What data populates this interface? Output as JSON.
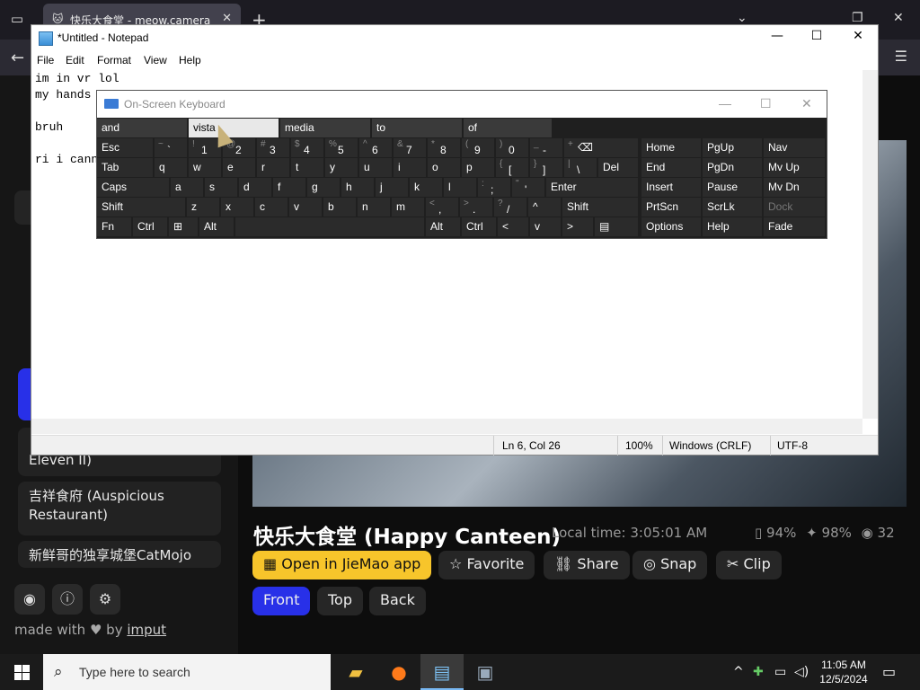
{
  "browser": {
    "tab_title": "快乐大食堂 - meow.camera",
    "tab_close": "✕",
    "new_tab": "+",
    "icons": [
      "tab-list-icon",
      "back-icon",
      "signin-icon",
      "hamburger-icon",
      "chevron-down-icon",
      "restore-icon",
      "close-icon"
    ]
  },
  "page": {
    "sidebar": {
      "items": [
        {
          "label": "Eleven II)"
        },
        {
          "label": "吉祥食府 (Auspicious Restaurant)"
        },
        {
          "label": "新鲜哥的独享城堡CatMojo"
        }
      ],
      "made_with_prefix": "made with",
      "made_with_heart": "♥",
      "made_with_by": "by",
      "made_with_link": "imput"
    },
    "camera": {
      "title": "快乐大食堂 (Happy Canteen)",
      "local_time": "Local time: 3:05:01 AM",
      "stats": {
        "battery": "94%",
        "signal": "98%",
        "viewers": "32"
      }
    },
    "actions": {
      "open_app": "Open in JieMao app",
      "favorite": "Favorite",
      "share": "Share",
      "snap": "Snap",
      "clip": "Clip"
    },
    "views": {
      "front": "Front",
      "top": "Top",
      "back": "Back"
    }
  },
  "notepad": {
    "title": "*Untitled - Notepad",
    "menus": {
      "file": "File",
      "edit": "Edit",
      "format": "Format",
      "view": "View",
      "help": "Help"
    },
    "content": "im in vr lol\nmy hands\n\nbruh\n\nri i cann",
    "status": {
      "position": "Ln 6, Col 26",
      "zoom": "100%",
      "eol": "Windows (CRLF)",
      "encoding": "UTF-8"
    },
    "winbtns": {
      "min": "—",
      "max": "☐",
      "close": "✕"
    }
  },
  "osk": {
    "title": "On-Screen Keyboard",
    "predictions": [
      "and",
      "vista",
      "media",
      "to",
      "of"
    ],
    "row1": {
      "esc": "Esc",
      "keys": [
        {
          "shift": "~",
          "main": "`"
        },
        {
          "shift": "!",
          "main": "1"
        },
        {
          "shift": "@",
          "main": "2"
        },
        {
          "shift": "#",
          "main": "3"
        },
        {
          "shift": "$",
          "main": "4"
        },
        {
          "shift": "%",
          "main": "5"
        },
        {
          "shift": "^",
          "main": "6"
        },
        {
          "shift": "&",
          "main": "7"
        },
        {
          "shift": "*",
          "main": "8"
        },
        {
          "shift": "(",
          "main": "9"
        },
        {
          "shift": ")",
          "main": "0"
        },
        {
          "shift": "_",
          "main": "-"
        },
        {
          "shift": "+",
          "main": "="
        }
      ],
      "backspace": "⌫",
      "nav": [
        "Home",
        "PgUp",
        "Nav"
      ]
    },
    "row2": {
      "tab": "Tab",
      "keys": [
        "q",
        "w",
        "e",
        "r",
        "t",
        "y",
        "u",
        "i",
        "o",
        "p"
      ],
      "brackets": [
        {
          "shift": "{",
          "main": "["
        },
        {
          "shift": "}",
          "main": "]"
        },
        {
          "shift": "|",
          "main": "\\"
        }
      ],
      "del": "Del",
      "nav": [
        "End",
        "PgDn",
        "Mv Up"
      ]
    },
    "row3": {
      "caps": "Caps",
      "keys": [
        "a",
        "s",
        "d",
        "f",
        "g",
        "h",
        "j",
        "k",
        "l"
      ],
      "punct": [
        {
          "shift": ":",
          "main": ";"
        },
        {
          "shift": "\"",
          "main": "'"
        }
      ],
      "enter": "Enter",
      "nav": [
        "Insert",
        "Pause",
        "Mv Dn"
      ]
    },
    "row4": {
      "shift_left": "Shift",
      "keys": [
        "z",
        "x",
        "c",
        "v",
        "b",
        "n",
        "m"
      ],
      "punct": [
        {
          "shift": "<",
          "main": ","
        },
        {
          "shift": ">",
          "main": "."
        },
        {
          "shift": "?",
          "main": "/"
        }
      ],
      "up": "^",
      "shift_right": "Shift",
      "nav": [
        "PrtScn",
        "ScrLk",
        "Dock"
      ]
    },
    "row5": {
      "fn": "Fn",
      "ctrl": "Ctrl",
      "win": "⊞",
      "alt": "Alt",
      "alt_r": "Alt",
      "ctrl_r": "Ctrl",
      "left": "<",
      "down": "v",
      "right": ">",
      "menu": "▤",
      "nav": [
        "Options",
        "Help",
        "Fade"
      ]
    }
  },
  "taskbar": {
    "search_placeholder": "Type here to search",
    "time": "11:05 AM",
    "date": "12/5/2024"
  }
}
